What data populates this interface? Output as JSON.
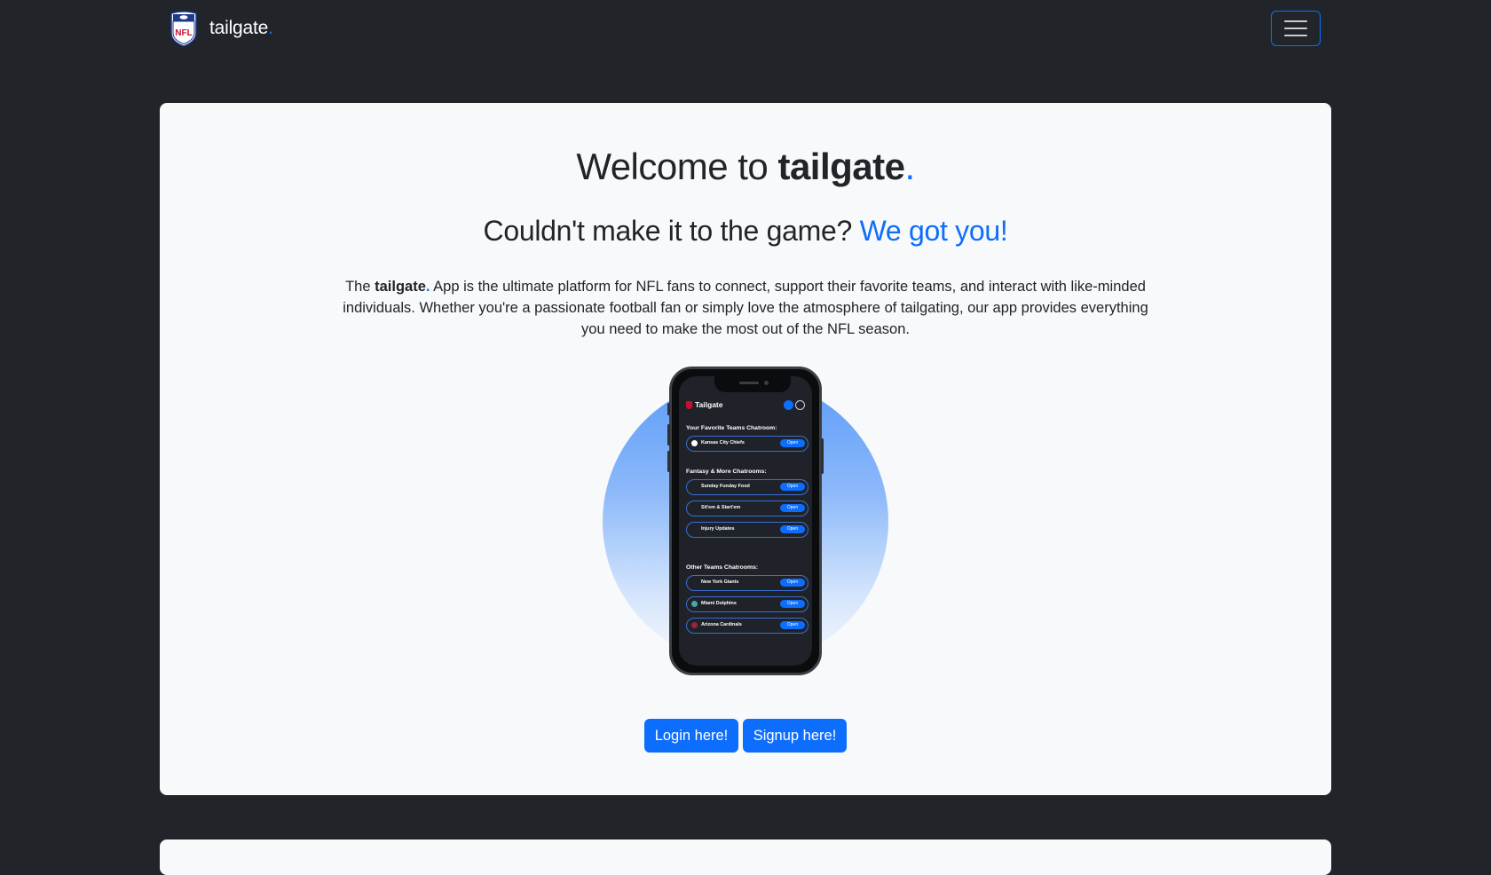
{
  "nav": {
    "brand": "tailgate",
    "brand_dot": ".",
    "logo_icon": "nfl-shield-icon",
    "menu_icon": "hamburger-menu-icon"
  },
  "hero": {
    "title_prefix": "Welcome to ",
    "title_brand": "tailgate",
    "title_dot": ".",
    "subtitle_main": "Couldn't make it to the game? ",
    "subtitle_accent": "We got you!",
    "intro_prefix": "The ",
    "intro_brand": "tailgate",
    "intro_dot": ".",
    "intro_body": " App is the ultimate platform for NFL fans to connect, support their favorite teams, and interact with like-minded individuals. Whether you're a passionate football fan or simply love the atmosphere of tailgating, our app provides everything you need to make the most out of the NFL season."
  },
  "phone": {
    "app_title": "Tailgate",
    "favorite_heading": "Your Favorite Teams Chatroom:",
    "fantasy_heading": "Fantasy & More Chatrooms:",
    "other_heading": "Other Teams Chatrooms:",
    "open_label": "Open",
    "favorite_rooms": [
      "Kansas City Chiefs"
    ],
    "fantasy_rooms": [
      "Sunday Funday Food",
      "Sit'em & Start'em",
      "Injury Updates"
    ],
    "other_rooms": [
      "New York Giants",
      "Miami Dolphins",
      "Arizona Cardinals"
    ]
  },
  "actions": {
    "login": "Login here!",
    "signup": "Signup here!"
  },
  "colors": {
    "accent": "#0d6efd",
    "background": "#212529",
    "card": "#f8f9fa"
  }
}
